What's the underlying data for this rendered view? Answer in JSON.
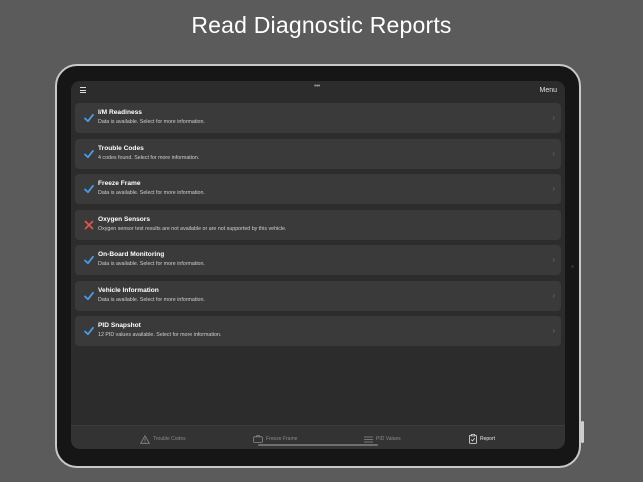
{
  "headline": "Read Diagnostic Reports",
  "topbar": {
    "menu_icon": "hamburger-icon",
    "more_indicator": "•••",
    "menu_label": "Menu"
  },
  "colors": {
    "check": "#4a9be8",
    "error": "#e0554d",
    "row_bg": "#3a3a3a",
    "screen_bg": "#2c2c2c",
    "page_bg": "#5b5b5c"
  },
  "items": [
    {
      "title": "I/M Readiness",
      "subtitle": "Data is available. Select for more information.",
      "status": "available"
    },
    {
      "title": "Trouble Codes",
      "subtitle": "4 codes found. Select for more information.",
      "status": "available"
    },
    {
      "title": "Freeze Frame",
      "subtitle": "Data is available. Select for more information.",
      "status": "available"
    },
    {
      "title": "Oxygen Sensors",
      "subtitle": "Oxygen sensor test results are not available or are not supported by this vehicle.",
      "status": "unavailable"
    },
    {
      "title": "On-Board Monitoring",
      "subtitle": "Data is available. Select for more information.",
      "status": "available"
    },
    {
      "title": "Vehicle Information",
      "subtitle": "Data is available. Select for more information.",
      "status": "available"
    },
    {
      "title": "PID Snapshot",
      "subtitle": "12 PID values available. Select for more information.",
      "status": "available"
    }
  ],
  "tabs": [
    {
      "label": "Trouble Codes",
      "icon": "warning-icon",
      "active": false
    },
    {
      "label": "Freeze Frame",
      "icon": "camera-icon",
      "active": false
    },
    {
      "label": "PID Values",
      "icon": "list-icon",
      "active": false
    },
    {
      "label": "Report",
      "icon": "clipboard-check-icon",
      "active": true
    }
  ]
}
